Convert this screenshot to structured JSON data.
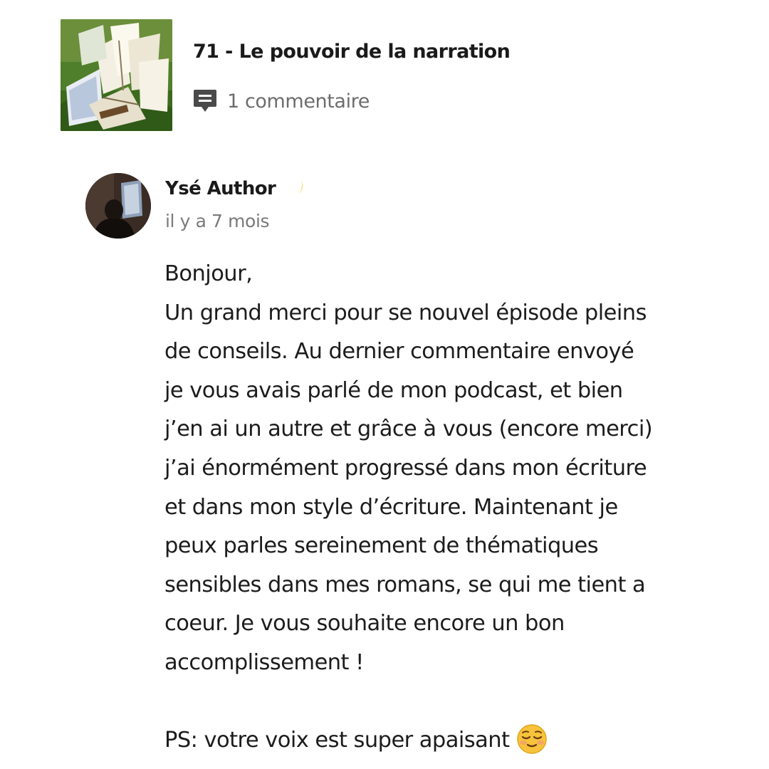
{
  "episode": {
    "title": "71 - Le pouvoir de la narration",
    "comments_label": "1 commentaire",
    "comments_icon": "comment-bubble-icon",
    "thumbnail": "open-books-on-grass-image"
  },
  "comment": {
    "author": "Ysé Author",
    "author_emoji": "crescent-moon-icon",
    "timestamp": "il y a 7 mois",
    "lines": [
      "Bonjour,",
      "Un grand merci pour se nouvel épisode pleins",
      "de conseils. Au dernier commentaire envoyé",
      "je vous avais parlé de mon podcast, et bien",
      "j’en ai un autre et grâce à vous (encore merci)",
      "j’ai énormément progressé dans mon écriture",
      "et dans mon style d’écriture. Maintenant je",
      "peux parles sereinement de thématiques",
      "sensibles dans mes romans, se qui me tient a",
      "coeur. Je vous souhaite encore un bon",
      "accomplissement !"
    ],
    "ps": "PS: votre voix est super apaisant",
    "ps_emoji": "relieved-face-emoji"
  },
  "colors": {
    "text": "#1c1c1c",
    "muted": "#6d6d6d",
    "icon": "#4a4a4a",
    "background": "#ffffff"
  }
}
